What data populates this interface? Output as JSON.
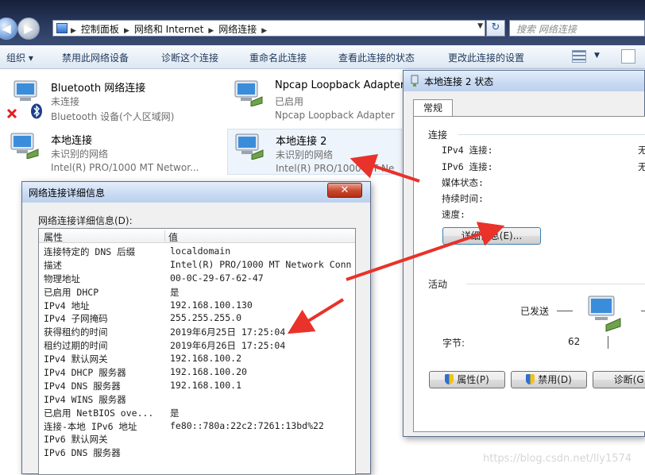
{
  "addressbar": {
    "crumbs": [
      "控制面板",
      "网络和 Internet",
      "网络连接"
    ],
    "search_placeholder": "搜索 网络连接"
  },
  "toolbar": {
    "items": [
      "组织 ▾",
      "禁用此网络设备",
      "诊断这个连接",
      "重命名此连接",
      "查看此连接的状态",
      "更改此连接的设置"
    ]
  },
  "connections": [
    {
      "name": "Bluetooth 网络连接",
      "status": "未连接",
      "device": "Bluetooth 设备(个人区域网)"
    },
    {
      "name": "Npcap Loopback Adapter",
      "status": "已启用",
      "device": "Npcap Loopback Adapter"
    },
    {
      "name": "本地连接",
      "status": "未识别的网络",
      "device": "Intel(R) PRO/1000 MT Networ..."
    },
    {
      "name": "本地连接 2",
      "status": "未识别的网络",
      "device": "Intel(R) PRO/1000 MT Ne"
    }
  ],
  "details_window": {
    "title": "网络连接详细信息",
    "label": "网络连接详细信息(D):",
    "col_property": "属性",
    "col_value": "值",
    "rows": [
      {
        "p": "连接特定的 DNS 后缀",
        "v": "localdomain"
      },
      {
        "p": "描述",
        "v": "Intel(R) PRO/1000 MT Network Conn"
      },
      {
        "p": "物理地址",
        "v": "00-0C-29-67-62-47"
      },
      {
        "p": "已启用 DHCP",
        "v": "是"
      },
      {
        "p": "IPv4 地址",
        "v": "192.168.100.130"
      },
      {
        "p": "IPv4 子网掩码",
        "v": "255.255.255.0"
      },
      {
        "p": "获得租约的时间",
        "v": "2019年6月25日 17:25:04"
      },
      {
        "p": "租约过期的时间",
        "v": "2019年6月26日 17:25:04"
      },
      {
        "p": "IPv4 默认网关",
        "v": "192.168.100.2"
      },
      {
        "p": "IPv4 DHCP 服务器",
        "v": "192.168.100.20"
      },
      {
        "p": "IPv4 DNS 服务器",
        "v": "192.168.100.1"
      },
      {
        "p": "IPv4 WINS 服务器",
        "v": ""
      },
      {
        "p": "已启用 NetBIOS ove...",
        "v": "是"
      },
      {
        "p": "连接-本地 IPv6 地址",
        "v": "fe80::780a:22c2:7261:13bd%22"
      },
      {
        "p": "IPv6 默认网关",
        "v": ""
      },
      {
        "p": "IPv6 DNS 服务器",
        "v": ""
      }
    ]
  },
  "status_window": {
    "title": "本地连接 2 状态",
    "tab": "常规",
    "section_connection": "连接",
    "ipv4": "IPv4 连接:",
    "ipv6": "IPv6 连接:",
    "media": "媒体状态:",
    "duration": "持续时间:",
    "speed": "速度:",
    "ipv4_value": "无",
    "ipv6_value": "无",
    "details_button": "详细信息(E)...",
    "section_activity": "活动",
    "sent_label": "已发送",
    "bytes_label": "字节:",
    "bytes_sent": "62",
    "btn_properties": "属性(P)",
    "btn_disable": "禁用(D)",
    "btn_diagnose": "诊断(G)"
  },
  "watermark": "https://blog.csdn.net/lly1574",
  "colors": {
    "arrow": "#e8322a",
    "title_gradient_top": "#e4eefb",
    "close_red": "#c8452c"
  }
}
